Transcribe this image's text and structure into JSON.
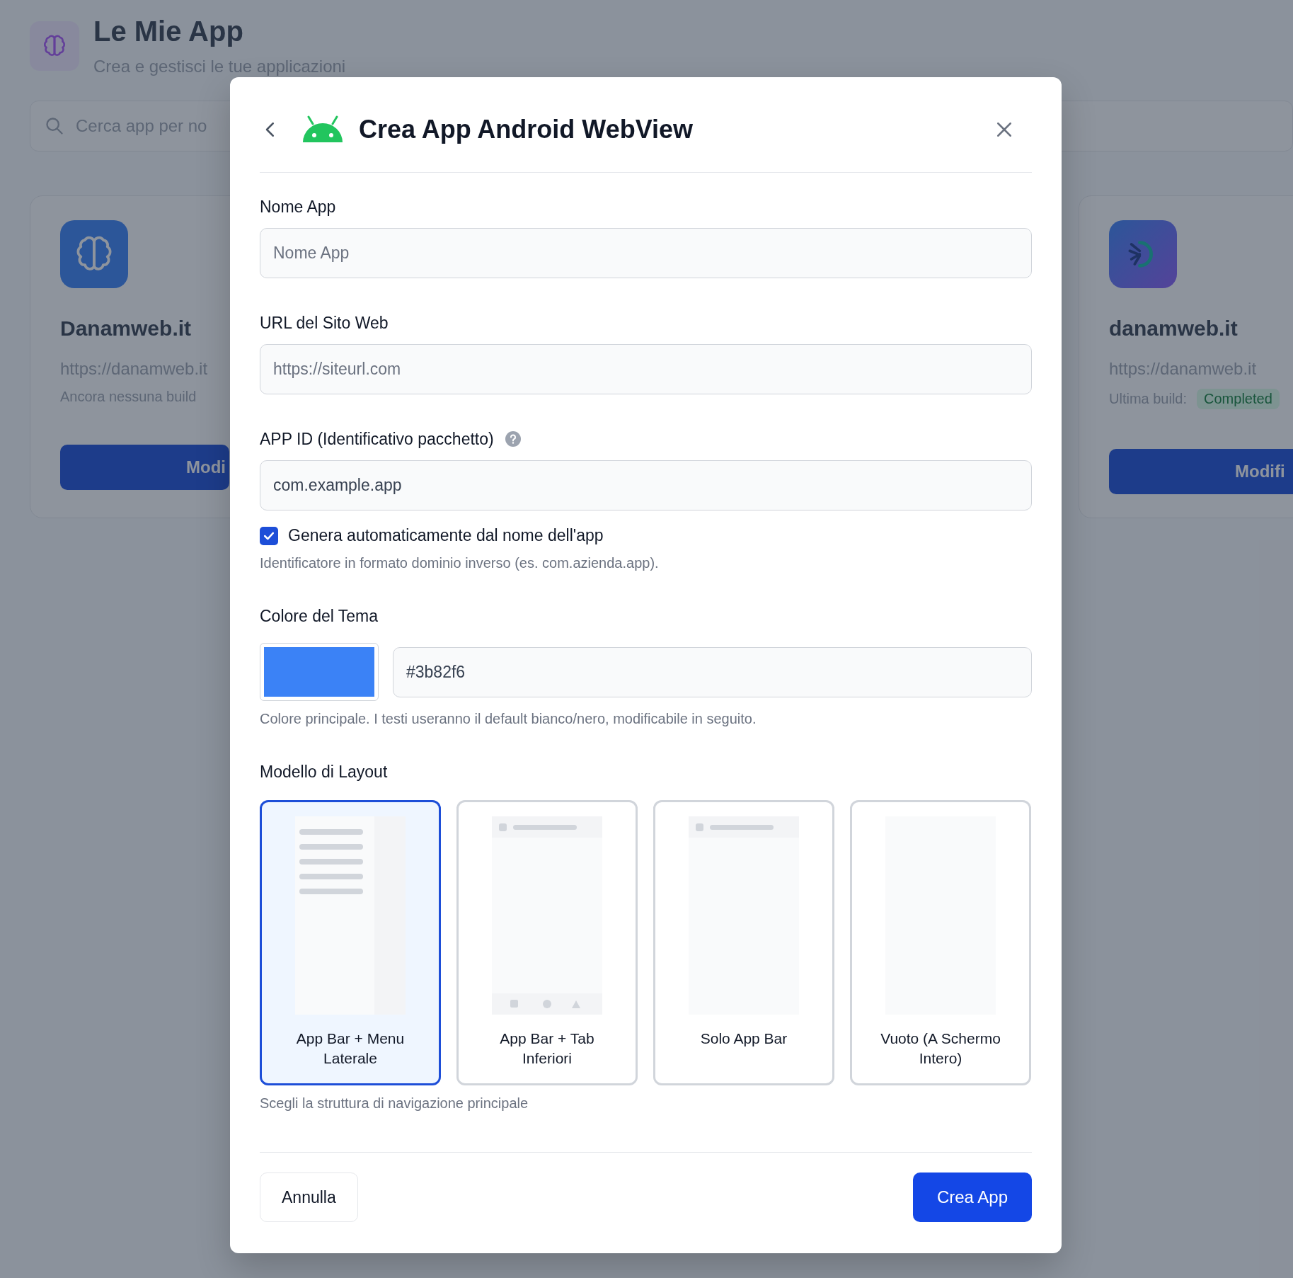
{
  "page": {
    "title": "Le Mie App",
    "subtitle": "Crea e gestisci le tue applicazioni",
    "search": {
      "placeholder": "Cerca app per no"
    },
    "apps": [
      {
        "kind": "brain",
        "name": "Danamweb.it",
        "url": "https://danamweb.it",
        "build_note": "Ancora nessuna build",
        "button": "Modi"
      },
      {
        "kind": "logo",
        "name": "danamweb.it",
        "url": "https://danamweb.it",
        "build_label": "Ultima build:",
        "build_status": "Completed",
        "button": "Modifi"
      }
    ]
  },
  "dialog": {
    "title": "Crea App Android WebView",
    "name_field": {
      "label": "Nome App",
      "placeholder": "Nome App"
    },
    "url_field": {
      "label": "URL del Sito Web",
      "placeholder": "https://siteurl.com"
    },
    "app_id_field": {
      "label": "APP ID (Identificativo pacchetto)",
      "value": "com.example.app"
    },
    "auto_generate": {
      "label": "Genera automaticamente dal nome dell'app",
      "checked": true
    },
    "app_id_hint": "Identificatore in formato dominio inverso (es. com.azienda.app).",
    "theme_color": {
      "label": "Colore del Tema",
      "value": "#3b82f6",
      "hint": "Colore principale. I testi useranno il default bianco/nero, modificabile in seguito."
    },
    "layout": {
      "label": "Modello di Layout",
      "hint": "Scegli la struttura di navigazione principale",
      "options": [
        {
          "kind": "side_menu",
          "label": "App Bar + Menu Laterale",
          "selected": true
        },
        {
          "kind": "bottom_tabs",
          "label": "App Bar + Tab Inferiori",
          "selected": false
        },
        {
          "kind": "app_bar",
          "label": "Solo App Bar",
          "selected": false
        },
        {
          "kind": "empty",
          "label": "Vuoto (A Schermo Intero)",
          "selected": false
        }
      ]
    },
    "cancel_button": "Annulla",
    "create_button": "Crea App"
  }
}
